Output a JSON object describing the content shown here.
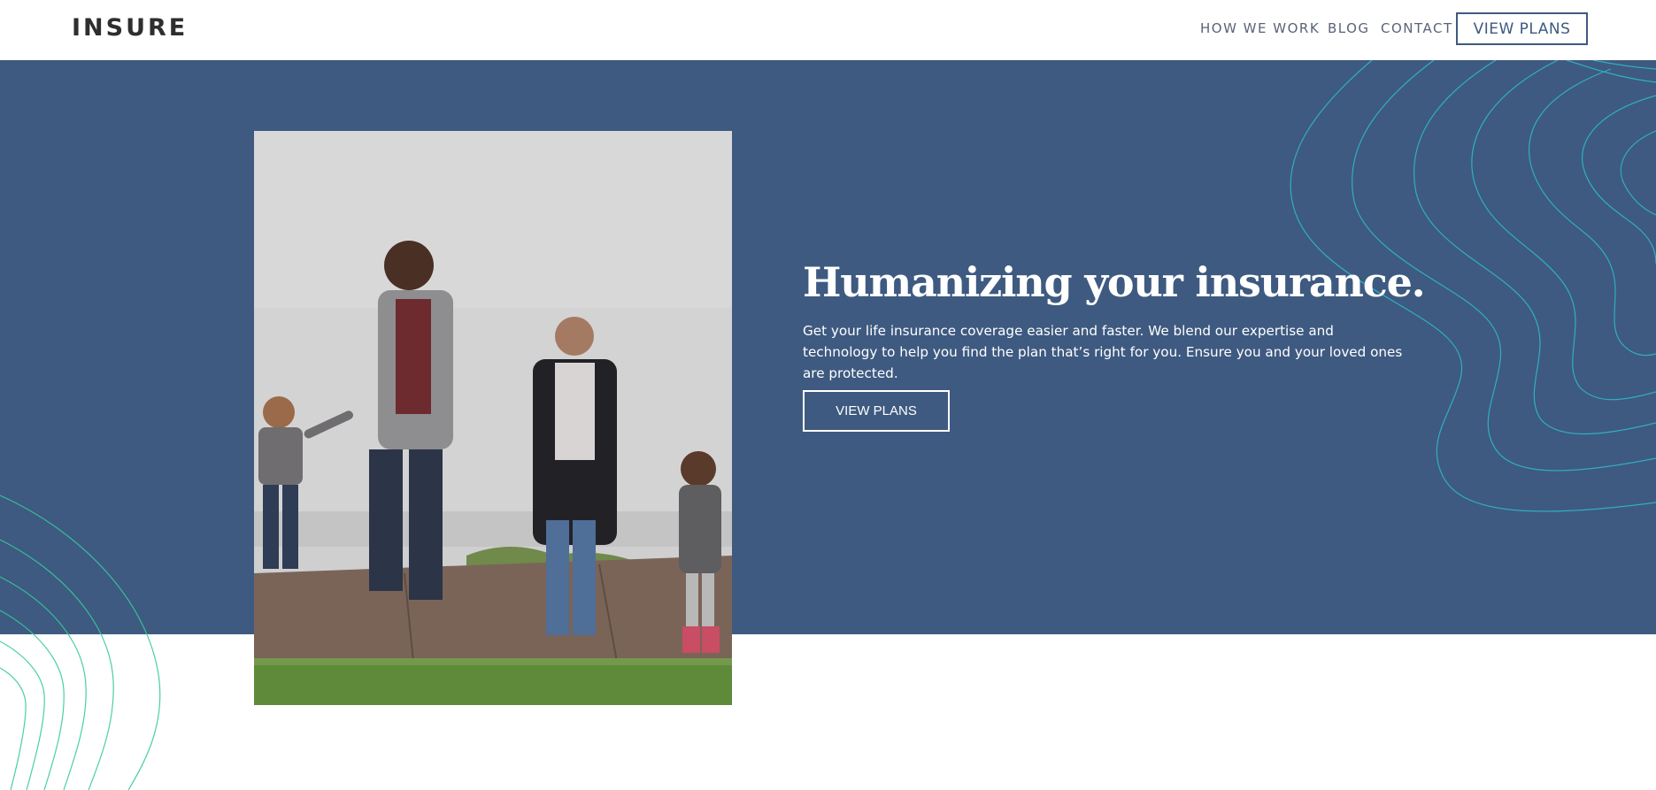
{
  "header": {
    "logo": "INSURE",
    "nav": [
      {
        "label": "HOW WE WORK"
      },
      {
        "label": "BLOG"
      },
      {
        "label": "CONTACT"
      }
    ],
    "cta_label": "VIEW PLANS"
  },
  "hero": {
    "title": "Humanizing your insurance.",
    "description": "Get your life insurance coverage easier and faster. We blend our expertise and technology to help you find the plan that’s right for you. Ensure you and your loved ones are protected.",
    "cta_label": "VIEW PLANS"
  },
  "colors": {
    "hero_bg": "#3e5a80",
    "pattern_right": "#2fb8c9",
    "pattern_left": "#36c9a0",
    "logo": "#2e2e2e"
  },
  "icons": {
    "hero_image": "family-photo",
    "decoration_right": "topographic-lines",
    "decoration_left": "topographic-lines"
  }
}
